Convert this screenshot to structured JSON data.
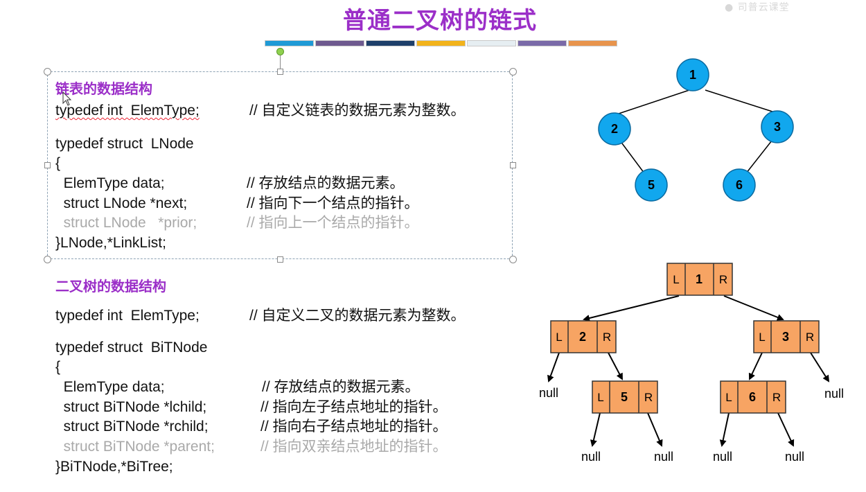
{
  "watermark": "● 司普云课堂",
  "slide_title": "普通二叉树的链式",
  "colors": {
    "title": "#9b2fc8",
    "bar": [
      "#1f9ad6",
      "#6e5a8f",
      "#1e3f6a",
      "#f2b31b",
      "#e6eef2",
      "#7a6aa8",
      "#e8944c"
    ],
    "tree_node": "#11a7ee",
    "cell_fill": "#f7a463",
    "code_grey": "#a9a9a9"
  },
  "linked_list": {
    "heading": "链表的数据结构",
    "lines": [
      {
        "code": "typedef int  ElemType;",
        "comment": "// 自定义链表的数据元素为整数。",
        "grey": false
      },
      {
        "code": "typedef struct  LNode",
        "comment": "",
        "grey": false
      },
      {
        "code": "{",
        "comment": "",
        "grey": false
      },
      {
        "code": "  ElemType data;",
        "comment": "// 存放结点的数据元素。",
        "grey": false
      },
      {
        "code": "  struct LNode *next;",
        "comment": "// 指向下一个结点的指针。",
        "grey": false
      },
      {
        "code": "  struct LNode   *prior;",
        "comment": "// 指向上一个结点的指针。",
        "grey": true
      },
      {
        "code": "}LNode,*LinkList;",
        "comment": "",
        "grey": false
      }
    ]
  },
  "binary_tree": {
    "heading": "二叉树的数据结构",
    "lines": [
      {
        "code": "typedef int  ElemType;",
        "comment": "// 自定义二叉的数据元素为整数。",
        "grey": false
      },
      {
        "code": "typedef struct  BiTNode",
        "comment": "",
        "grey": false
      },
      {
        "code": "{",
        "comment": "",
        "grey": false
      },
      {
        "code": "  ElemType data;",
        "comment": "// 存放结点的数据元素。",
        "grey": false
      },
      {
        "code": "  struct BiTNode *lchild;",
        "comment": "// 指向左子结点地址的指针。",
        "grey": false
      },
      {
        "code": "  struct BiTNode *rchild;",
        "comment": "// 指向右子结点地址的指针。",
        "grey": false
      },
      {
        "code": "  struct BiTNode *parent;",
        "comment": "// 指向双亲结点地址的指针。",
        "grey": true
      },
      {
        "code": "}BiTNode,*BiTree;",
        "comment": "",
        "grey": false
      }
    ]
  },
  "tree_diagram": {
    "nodes": [
      "1",
      "2",
      "3",
      "5",
      "6"
    ]
  },
  "linked_tree": {
    "left_label": "L",
    "right_label": "R",
    "null_label": "null",
    "nodes": [
      "1",
      "2",
      "3",
      "5",
      "6"
    ]
  }
}
